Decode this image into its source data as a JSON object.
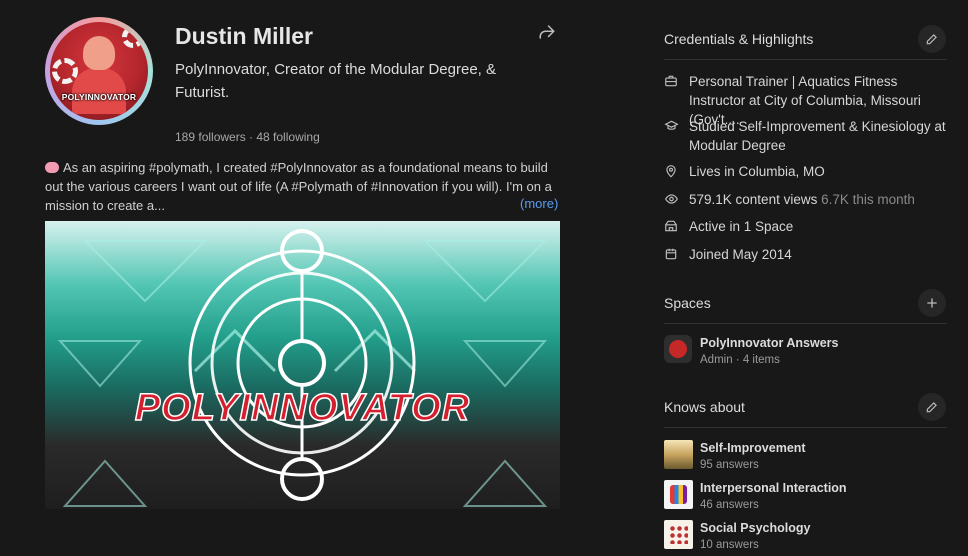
{
  "profile": {
    "name": "Dustin Miller",
    "tagline": "PolyInnovator, Creator of the Modular Degree, & Futurist.",
    "avatar_text": "POLYINNOVATOR",
    "follow_line": "189 followers · 48 following",
    "bio": "As an aspiring #polymath, I created #PolyInnovator as a foundational means to build out the various careers I want out of life (A #Polymath of #Innovation if you will). I'm on a mission to create a...",
    "more_label": "(more)",
    "banner_text": "POLYINNOVATOR"
  },
  "credentials": {
    "title": "Credentials & Highlights",
    "items": [
      {
        "icon": "briefcase-icon",
        "text": "Personal Trainer | Aquatics Fitness Instructor at City of Columbia, Missouri (Gov't...."
      },
      {
        "icon": "graduation-cap-icon",
        "text": "Studied Self-Improvement & Kinesiology at Modular Degree"
      },
      {
        "icon": "location-pin-icon",
        "text": "Lives in Columbia, MO"
      },
      {
        "icon": "eye-icon",
        "text": "579.1K content views",
        "muted": "6.7K this month"
      },
      {
        "icon": "spaces-icon",
        "text": "Active in 1 Space"
      },
      {
        "icon": "calendar-icon",
        "text": "Joined May 2014"
      }
    ]
  },
  "spaces": {
    "title": "Spaces",
    "items": [
      {
        "name": "PolyInnovator Answers",
        "meta": "Admin · 4 items"
      }
    ]
  },
  "knows_about": {
    "title": "Knows about",
    "items": [
      {
        "name": "Self-Improvement",
        "meta": "95 answers"
      },
      {
        "name": "Interpersonal Interaction",
        "meta": "46 answers"
      },
      {
        "name": "Social Psychology",
        "meta": "10 answers"
      }
    ]
  },
  "colors": {
    "background": "#181818",
    "link": "#5a9df0",
    "banner_red": "#d4202e",
    "banner_teal": "#23a08c"
  }
}
